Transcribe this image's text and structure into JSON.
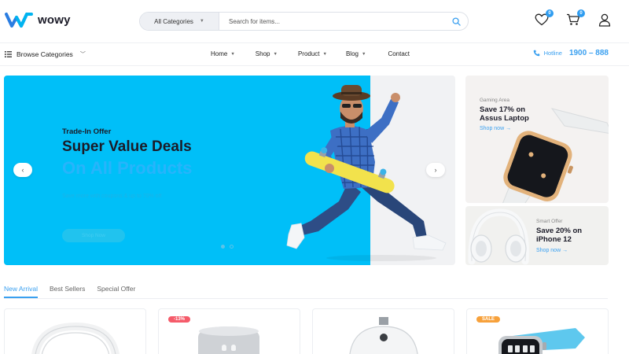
{
  "header": {
    "logo_text": "wowy",
    "category_select": "All Categories",
    "search_placeholder": "Search for items...",
    "wishlist_count": "0",
    "cart_count": "0"
  },
  "nav": {
    "browse_label": "Browse Categories",
    "links": [
      "Home",
      "Shop",
      "Product",
      "Blog",
      "Contact"
    ],
    "hotline_label": "Hotline",
    "hotline_number": "1900 – 888"
  },
  "hero": {
    "subtitle": "Trade-In Offer",
    "title": "Super Value Deals",
    "title2": "On All Products",
    "description": "Save more with coupons & up to 70% off",
    "button_label": "Shop Now"
  },
  "banners": [
    {
      "kicker": "Gaming Area",
      "title_line1": "Save 17% on",
      "title_line2": "Assus Laptop",
      "link": "Shop now →"
    },
    {
      "kicker": "Smart Offer",
      "title_line1": "Save 20% on",
      "title_line2": "iPhone 12",
      "link": "Shop now →"
    }
  ],
  "tabs": [
    "New Arrival",
    "Best Sellers",
    "Special Offer"
  ],
  "cards": [
    {
      "badge": ""
    },
    {
      "badge": "-13%"
    },
    {
      "badge": ""
    },
    {
      "badge": "SALE"
    }
  ],
  "colors": {
    "accent": "#3aa0f0",
    "hero_bg": "#00bff8",
    "badge_discount": "#f55b6a",
    "badge_sale": "#f7a13b"
  }
}
